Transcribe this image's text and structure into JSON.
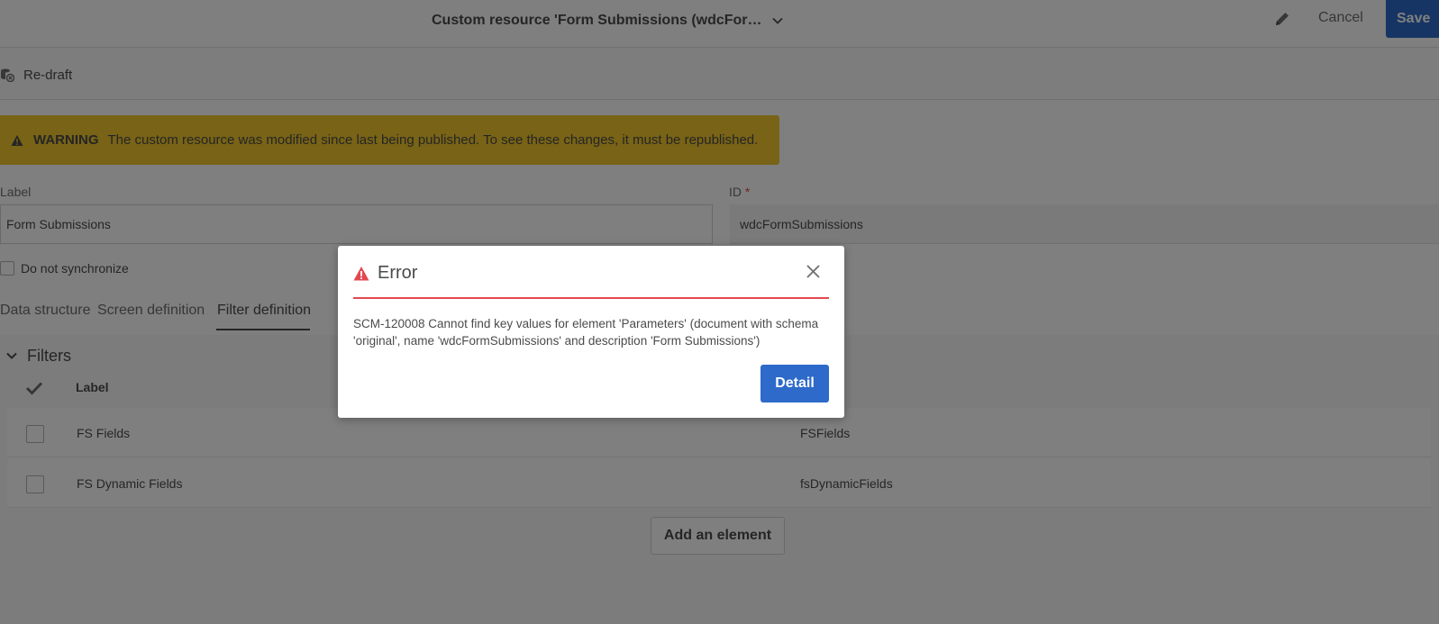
{
  "header": {
    "title": "Custom resource 'Form Submissions (wdcFor…",
    "cancel_label": "Cancel",
    "save_label": "Save"
  },
  "toolbar": {
    "redraft_label": "Re-draft"
  },
  "warning": {
    "label": "WARNING",
    "message": "The custom resource was modified since last being published. To see these changes, it must be republished."
  },
  "form": {
    "label_field_label": "Label",
    "label_value": "Form Submissions",
    "id_field_label": "ID",
    "id_required_mark": "*",
    "id_value": "wdcFormSubmissions",
    "sync_checkbox_label": "Do not synchronize"
  },
  "tabs": [
    {
      "label": "Data structure"
    },
    {
      "label": "Screen definition"
    },
    {
      "label": "Filter definition"
    }
  ],
  "filters": {
    "title": "Filters",
    "column_label": "Label",
    "rows": [
      {
        "label": "FS Fields",
        "id": "FSFields"
      },
      {
        "label": "FS Dynamic Fields",
        "id": "fsDynamicFields"
      }
    ],
    "add_button_label": "Add an element"
  },
  "dialog": {
    "title": "Error",
    "message": "SCM-120008 Cannot find key values for element 'Parameters' (document with schema 'original', name 'wdcFormSubmissions' and description 'Form Submissions')",
    "detail_label": "Detail"
  },
  "colors": {
    "primary": "#2d6ac9",
    "warning": "#f0c72c",
    "error": "#e34850"
  }
}
